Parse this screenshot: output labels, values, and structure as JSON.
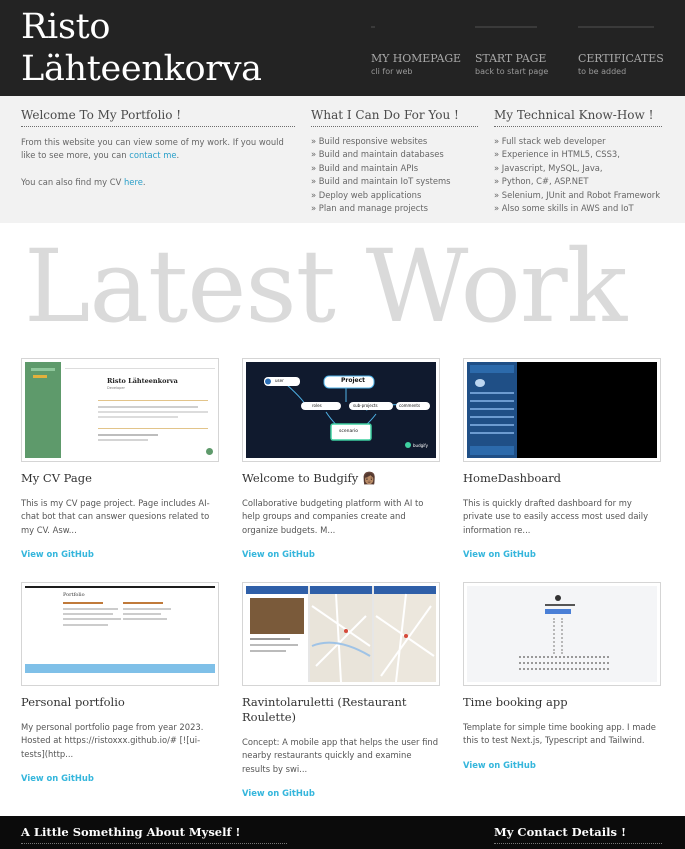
{
  "header": {
    "title": "Risto Lähteenkorva",
    "nav": [
      {
        "label": "MY HOMEPAGE",
        "sub": "cli for web"
      },
      {
        "label": "START PAGE",
        "sub": "back to start page"
      },
      {
        "label": "CERTIFICATES",
        "sub": "to be added"
      }
    ]
  },
  "welcome": {
    "title": "Welcome To My Portfolio !",
    "p1_text": "From this website you can view some of my work. If you would like to see more, you can",
    "p1_link": "contact me",
    "p1_end": ".",
    "p2_text": "You can also find my CV",
    "p2_link": "here",
    "p2_end": "."
  },
  "services": {
    "title": "What I Can Do For You !",
    "items": [
      "» Build responsive websites",
      "» Build and maintain databases",
      "» Build and maintain APIs",
      "» Build and maintain IoT systems",
      "» Deploy web applications",
      "» Plan and manage projects"
    ]
  },
  "knowhow": {
    "title": "My Technical Know-How !",
    "items": [
      "» Full stack web developer",
      "» Experience in HTML5, CSS3,",
      "» Javascript, MySQL, Java,",
      "» Python, C#, ASP.NET",
      "» Selenium, JUnit and Robot Framework",
      "» Also some skills in AWS and IoT"
    ]
  },
  "latest_work": {
    "heading": "Latest Work",
    "projects": [
      {
        "title": "My CV Page",
        "desc": "This is my CV page project. Page includes AI-chat bot that can answer quesions related to my CV. Asw...",
        "link": "View on GitHub"
      },
      {
        "title": "Welcome to Budgify 👩🏽",
        "desc": "Collaborative budgeting platform with AI to help groups and companies create and organize budgets. M...",
        "link": "View on GitHub"
      },
      {
        "title": "HomeDashboard",
        "desc": "This is quickly drafted dashboard for my private use to easily access most used daily information re...",
        "link": "View on GitHub"
      },
      {
        "title": "Personal portfolio",
        "desc": "My personal portfolio page from year 2023. Hosted at https://ristoxxx.github.io/# [![ui-tests](http...",
        "link": "View on GitHub"
      },
      {
        "title": "Ravintolaruletti (Restaurant Roulette)",
        "desc": "Concept: A mobile app that helps the user find nearby restaurants quickly and examine results by swi...",
        "link": "View on GitHub"
      },
      {
        "title": "Time booking app",
        "desc": "Template for simple time booking app. I made this to test Next.js, Typescript and Tailwind.",
        "link": "View on GitHub"
      }
    ]
  },
  "thumbs": {
    "cv_name": "Risto Lähteenkorva",
    "cv_role": "Developer",
    "budgify_center": "Project",
    "budgify_node1": "user",
    "budgify_node2": "sub-projects",
    "budgify_node3": "scenario",
    "budgify_node4": "comments",
    "budgify_node5": "roles",
    "budgify_logo": "budgify",
    "pf_title": "Portfolio"
  },
  "footer": {
    "about_title": "A Little Something About Myself !",
    "contact_title": "My Contact Details !"
  },
  "colors": {
    "header_bg": "#232323",
    "band_bg": "#f2f2f2",
    "link": "#35b6dc",
    "footer_bg": "#0b0b0b"
  }
}
